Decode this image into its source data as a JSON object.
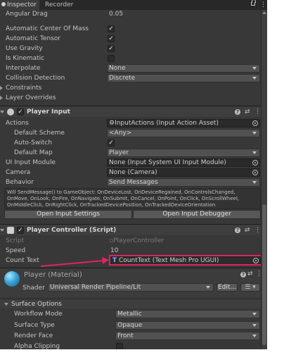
{
  "tabs": {
    "inspector": "Inspector",
    "recorder": "Recorder"
  },
  "rigidbody": {
    "angular_drag_label": "Angular Drag",
    "angular_drag_value": "0.05",
    "auto_center_label": "Automatic Center Of Mass",
    "auto_tensor_label": "Automatic Tensor",
    "use_gravity_label": "Use Gravity",
    "is_kinematic_label": "Is Kinematic",
    "interpolate_label": "Interpolate",
    "interpolate_value": "None",
    "collision_label": "Collision Detection",
    "collision_value": "Discrete",
    "constraints_label": "Constraints",
    "layer_overrides_label": "Layer Overrides"
  },
  "player_input": {
    "title": "Player Input",
    "actions_label": "Actions",
    "actions_value": "InputActions (Input Action Asset)",
    "default_scheme_label": "Default Scheme",
    "default_scheme_value": "<Any>",
    "auto_switch_label": "Auto-Switch",
    "default_map_label": "Default Map",
    "default_map_value": "Player",
    "ui_module_label": "UI Input Module",
    "ui_module_value": "None (Input System UI Input Module)",
    "camera_label": "Camera",
    "camera_value": "None (Camera)",
    "behavior_label": "Behavior",
    "behavior_value": "Send Messages",
    "info_text": "Will SendMessage() to GameObject: OnDeviceLost, OnDeviceRegained, OnControlsChanged, OnMove, OnLook, OnFire, OnNavigate, OnSubmit, OnCancel, OnPoint, OnClick, OnScrollWheel, OnMiddleClick, OnRightClick, OnTrackedDevicePosition, OnTrackedDeviceOrientation",
    "open_settings_label": "Open Input Settings",
    "open_debugger_label": "Open Input Debugger"
  },
  "player_controller": {
    "title": "Player Controller (Script)",
    "script_label": "Script",
    "script_value": "PlayerController",
    "speed_label": "Speed",
    "speed_value": "10",
    "count_text_label": "Count Text",
    "count_text_value": "CountText (Text Mesh Pro UGUI)"
  },
  "material": {
    "title": "Player (Material)",
    "shader_label": "Shader",
    "shader_value": "Universal Render Pipeline/Lit",
    "edit_label": "Edit..."
  },
  "surface": {
    "section_title": "Surface Options",
    "workflow_label": "Workflow Mode",
    "workflow_value": "Metallic",
    "surface_type_label": "Surface Type",
    "surface_type_value": "Opaque",
    "render_face_label": "Render Face",
    "render_face_value": "Front",
    "alpha_clipping_label": "Alpha Clipping"
  },
  "colors": {
    "highlight": "#e0245e",
    "panel_bg": "#383838"
  }
}
